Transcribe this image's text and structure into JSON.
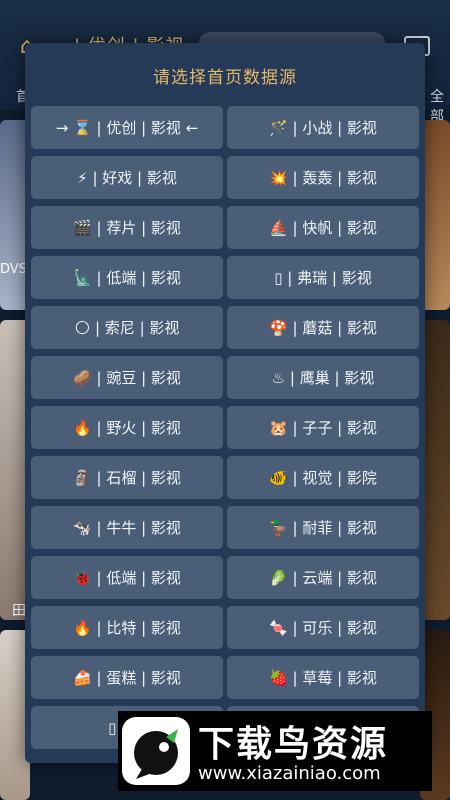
{
  "background": {
    "app_title": "| 优创 | 影视",
    "tab_left": "首",
    "tab_right": "全部",
    "card_text_1": "DVS",
    "card_text_2": "田"
  },
  "dialog": {
    "title": "请选择首页数据源",
    "options": [
      {
        "label": "→ ⌛ | 优创 | 影视 ←",
        "icon": "hourglass-icon"
      },
      {
        "label": "🪄 | 小战 | 影视",
        "icon": "wand-icon"
      },
      {
        "label": "⚡ | 好戏 | 影视",
        "icon": "lightning-icon"
      },
      {
        "label": "💥 | 轰轰 | 影视",
        "icon": "explosion-icon"
      },
      {
        "label": "🎬 | 荐片 | 影视",
        "icon": "clapper-icon"
      },
      {
        "label": "⛵ | 快帆 | 影视",
        "icon": "sailboat-icon"
      },
      {
        "label": "🗽 | 低端 | 影视",
        "icon": "statue-icon"
      },
      {
        "label": "▯ | 弗瑞 | 影视",
        "icon": "missing-glyph-icon"
      },
      {
        "label": "🌕 | 索尼 | 影视",
        "icon": "moon-icon"
      },
      {
        "label": "🍄 | 蘑菇 | 影视",
        "icon": "mushroom-icon"
      },
      {
        "label": "🥔 | 豌豆 | 影视",
        "icon": "potato-icon"
      },
      {
        "label": "♨ | 鹰巢 | 影视",
        "icon": "hot-springs-icon"
      },
      {
        "label": "🔥 | 野火 | 影视",
        "icon": "fire-icon"
      },
      {
        "label": "🐹 | 子子 | 影视",
        "icon": "hamster-icon"
      },
      {
        "label": "🗿 | 石榴 | 影视",
        "icon": "moai-icon"
      },
      {
        "label": "🐠 | 视觉 | 影院",
        "icon": "fish-icon"
      },
      {
        "label": "🐄 | 牛牛 | 影视",
        "icon": "cow-icon"
      },
      {
        "label": "🦆 | 耐菲 | 影视",
        "icon": "duck-icon"
      },
      {
        "label": "🐞 | 低端 | 影视",
        "icon": "ladybug-icon"
      },
      {
        "label": "🥬 | 云端 | 影视",
        "icon": "greens-icon"
      },
      {
        "label": "🔥 | 比特 | 影视",
        "icon": "fire-icon"
      },
      {
        "label": "🍬 | 可乐 | 影视",
        "icon": "candy-icon"
      },
      {
        "label": "🍰 | 蛋糕 | 影视",
        "icon": "cake-icon"
      },
      {
        "label": "🍓 | 草莓 | 影视",
        "icon": "strawberry-icon"
      },
      {
        "label": "▯ | 剧",
        "icon": "missing-glyph-icon"
      },
      {
        "label": "",
        "icon": ""
      }
    ]
  },
  "watermark": {
    "title": "下载鸟资源",
    "url": "www.xiazainiao.com"
  },
  "colors": {
    "accent": "#e6b86a",
    "dialog_bg": "#243a57",
    "option_bg": "#4a5e78"
  }
}
